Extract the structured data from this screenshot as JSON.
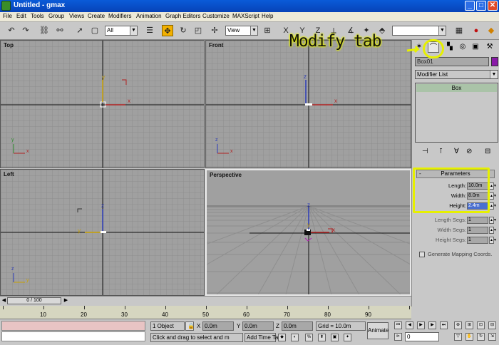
{
  "window": {
    "title": "Untitled - gmax",
    "min_label": "_",
    "max_label": "□",
    "close_label": "✕"
  },
  "menu": [
    "File",
    "Edit",
    "Tools",
    "Group",
    "Views",
    "Create",
    "Modifiers",
    "Animation",
    "Graph Editors",
    "Customize",
    "MAXScript",
    "Help"
  ],
  "toolbar": {
    "filter_value": "All",
    "coord_value": "View",
    "axis_x": "X",
    "axis_y": "Y",
    "axis_z": "Z",
    "icons": [
      "undo-icon",
      "redo-icon",
      "link-icon",
      "unlink-icon",
      "select-icon",
      "region-select-icon",
      "select-by-name-icon",
      "move-icon",
      "rotate-icon",
      "scale-icon",
      "manipulate-icon",
      "pivot-icon",
      "snap-icon",
      "angle-snap-icon",
      "percent-snap-icon",
      "spinner-snap-icon"
    ]
  },
  "viewports": {
    "top": {
      "label": "Top",
      "axis_x": "x",
      "axis_y": "y"
    },
    "front": {
      "label": "Front",
      "axis_x": "x",
      "axis_z": "z"
    },
    "left": {
      "label": "Left",
      "axis_y": "y",
      "axis_z": "z"
    },
    "perspective": {
      "label": "Perspective",
      "axis_x": "x",
      "axis_y": "y",
      "axis_z": "z"
    }
  },
  "command_panel": {
    "tabs": [
      "create-tab",
      "modify-tab",
      "hierarchy-tab",
      "motion-tab",
      "display-tab",
      "utilities-tab"
    ],
    "object_name": "Box01",
    "object_color": "#8a1aa8",
    "modifier_list": "Modifier List",
    "stack_items": [
      "Box"
    ],
    "rollout_title": "Parameters",
    "rollout_sign": "-",
    "params": [
      {
        "label": "Length:",
        "value": "10.0m",
        "selected": false,
        "dim": false
      },
      {
        "label": "Width:",
        "value": "8.0m",
        "selected": false,
        "dim": false
      },
      {
        "label": "Height:",
        "value": "2.4m",
        "selected": true,
        "dim": false
      },
      {
        "label": "Length Segs:",
        "value": "1",
        "selected": false,
        "dim": true
      },
      {
        "label": "Width Segs:",
        "value": "1",
        "selected": false,
        "dim": true
      },
      {
        "label": "Height Segs:",
        "value": "1",
        "selected": false,
        "dim": true
      }
    ],
    "gen_mapping": "Generate Mapping Coords."
  },
  "annotation": {
    "text": "Modify tab",
    "color": "#e6f000"
  },
  "timeline": {
    "slider_label": "0 / 100",
    "ticks": [
      10,
      20,
      30,
      40,
      50,
      60,
      70,
      80,
      90
    ]
  },
  "status": {
    "selection": "1 Object",
    "x_label": "X",
    "x_value": "0.0m",
    "y_label": "Y",
    "y_value": "0.0m",
    "z_label": "Z",
    "z_value": "0.0m",
    "grid": "Grid = 10.0m",
    "prompt": "Click and drag to select and m",
    "add_time_tag": "Add Time Tag",
    "animate": "Animate",
    "frame": "0"
  }
}
